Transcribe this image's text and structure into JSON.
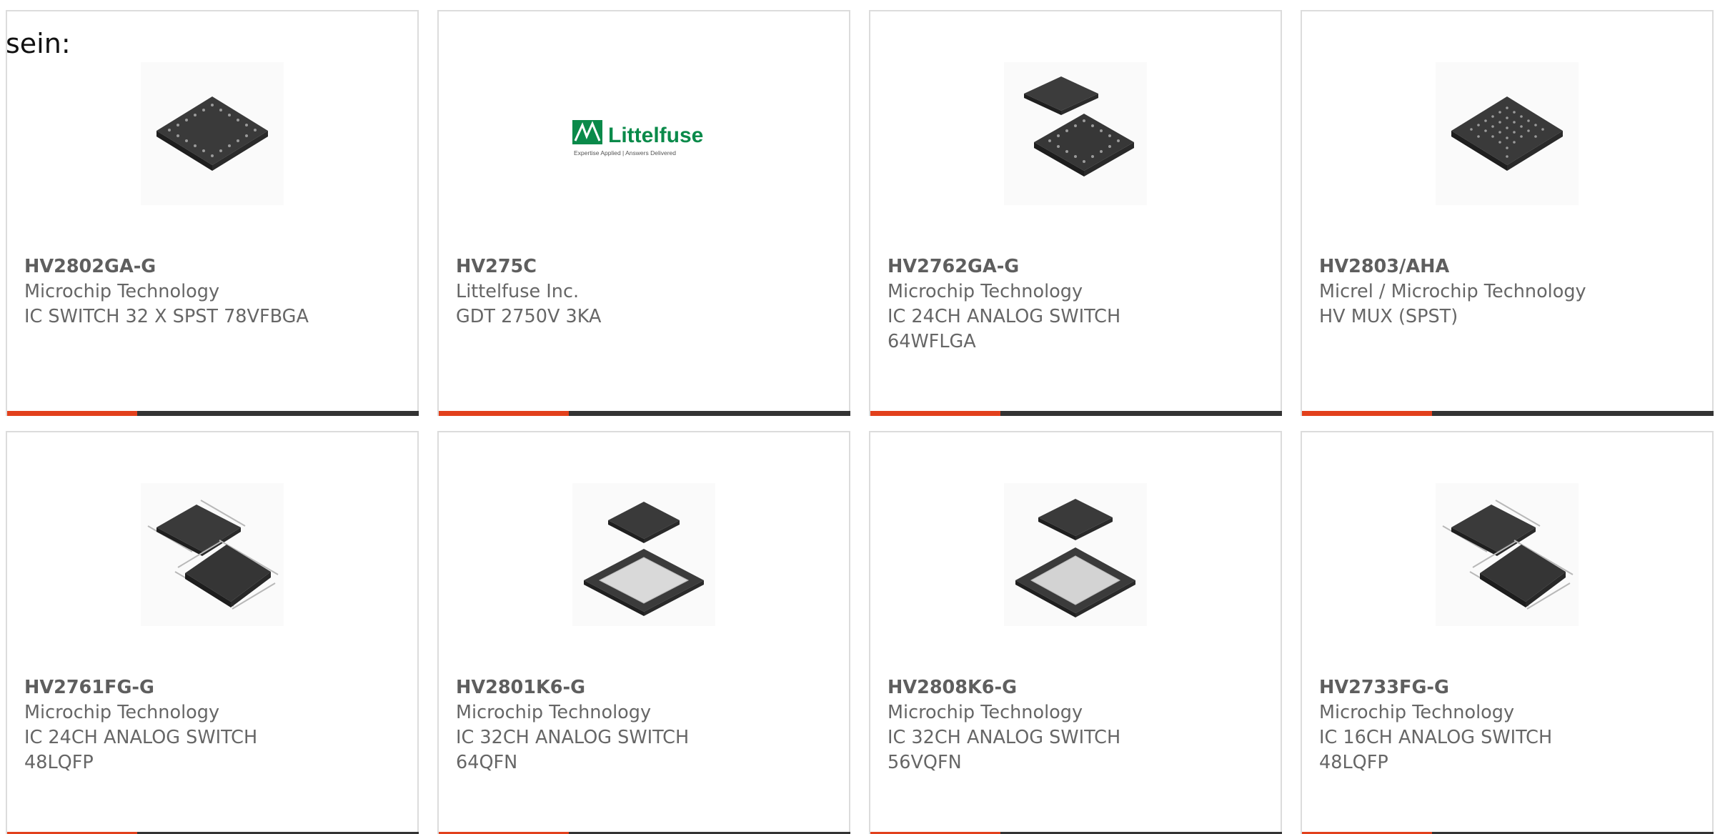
{
  "intro_text": "sein:",
  "colors": {
    "accent": "#e2401c",
    "bar_dark": "#333333",
    "text_gray": "#666666",
    "card_border": "#dcdcdc"
  },
  "products": [
    {
      "part_number": "HV2802GA-G",
      "manufacturer": "Microchip Technology",
      "description": "IC SWITCH 32 X SPST 78VFBGA",
      "image": "bga-chip-image"
    },
    {
      "part_number": "HV275C",
      "manufacturer": "Littelfuse Inc.",
      "description": "GDT 2750V 3KA",
      "image": "littelfuse-logo",
      "logo_text": "Littelfuse",
      "logo_tagline": "Expertise Applied | Answers Delivered"
    },
    {
      "part_number": "HV2762GA-G",
      "manufacturer": "Microchip Technology",
      "description": "IC 24CH ANALOG SWITCH 64WFLGA",
      "image": "lga-chip-image"
    },
    {
      "part_number": "HV2803/AHA",
      "manufacturer": "Micrel / Microchip Technology",
      "description": "HV MUX (SPST)",
      "image": "bga-chip-image"
    },
    {
      "part_number": "HV2761FG-G",
      "manufacturer": "Microchip Technology",
      "description": "IC 24CH ANALOG SWITCH 48LQFP",
      "image": "lqfp-chip-image"
    },
    {
      "part_number": "HV2801K6-G",
      "manufacturer": "Microchip Technology",
      "description": "IC 32CH ANALOG SWITCH 64QFN",
      "image": "qfn-chip-image"
    },
    {
      "part_number": "HV2808K6-G",
      "manufacturer": "Microchip Technology",
      "description": "IC 32CH ANALOG SWITCH 56VQFN",
      "image": "qfn-chip-image"
    },
    {
      "part_number": "HV2733FG-G",
      "manufacturer": "Microchip Technology",
      "description": "IC 16CH ANALOG SWITCH 48LQFP",
      "image": "lqfp-chip-image"
    }
  ]
}
